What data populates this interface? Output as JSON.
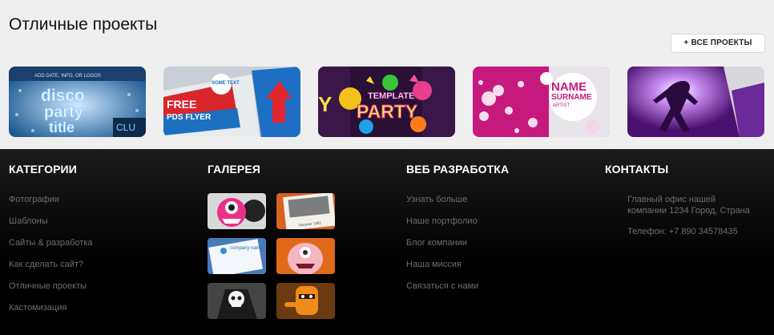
{
  "projects": {
    "title": "Отличные проекты",
    "all_button": "ВСЕ ПРОЕКТЫ",
    "all_button_icon": "plus-icon",
    "thumbnails": [
      {
        "name": "disco-party-flyer",
        "lines": [
          "disco",
          "party",
          "title"
        ],
        "top_text": "ADD DATE, INFO, OR LOGOS",
        "side_text": "CLU"
      },
      {
        "name": "free-psd-flyer",
        "lines": [
          "FREE",
          "PDS FLYER"
        ],
        "badge": "SOME TEXT"
      },
      {
        "name": "template-party-flyer",
        "lines": [
          "TEMPLATE",
          "PARTY"
        ]
      },
      {
        "name": "name-surname-artist-flyer",
        "lines": [
          "NAME",
          "SURNAME",
          "ARTIST"
        ]
      },
      {
        "name": "purple-dancer-flyer",
        "lines": []
      }
    ]
  },
  "footer": {
    "categories": {
      "heading": "КАТЕГОРИИ",
      "links": [
        "Фотографии",
        "Шаблоны",
        "Сайты & разработка",
        "Как сделать сайт?",
        "Отличные проекты",
        "Кастомизация"
      ]
    },
    "gallery": {
      "heading": "ГАЛЕРЕЯ",
      "items": [
        "pink-monster",
        "photo-print",
        "business-card",
        "pink-character",
        "skull-reaper",
        "orange-character"
      ],
      "photo_caption": "Summer 1982",
      "card_text": "company name"
    },
    "web": {
      "heading": "ВЕБ РАЗРАБОТКА",
      "links": [
        "Узнать больше",
        "Наше портфолио",
        "Блог компании",
        "Наша миссия",
        "Связаться с нами"
      ]
    },
    "contacts": {
      "heading": "КОНТАКТЫ",
      "address": "Главный офис нашей компании 1234 Город, Страна",
      "phone": "Телефон: +7 890 34578435"
    }
  }
}
